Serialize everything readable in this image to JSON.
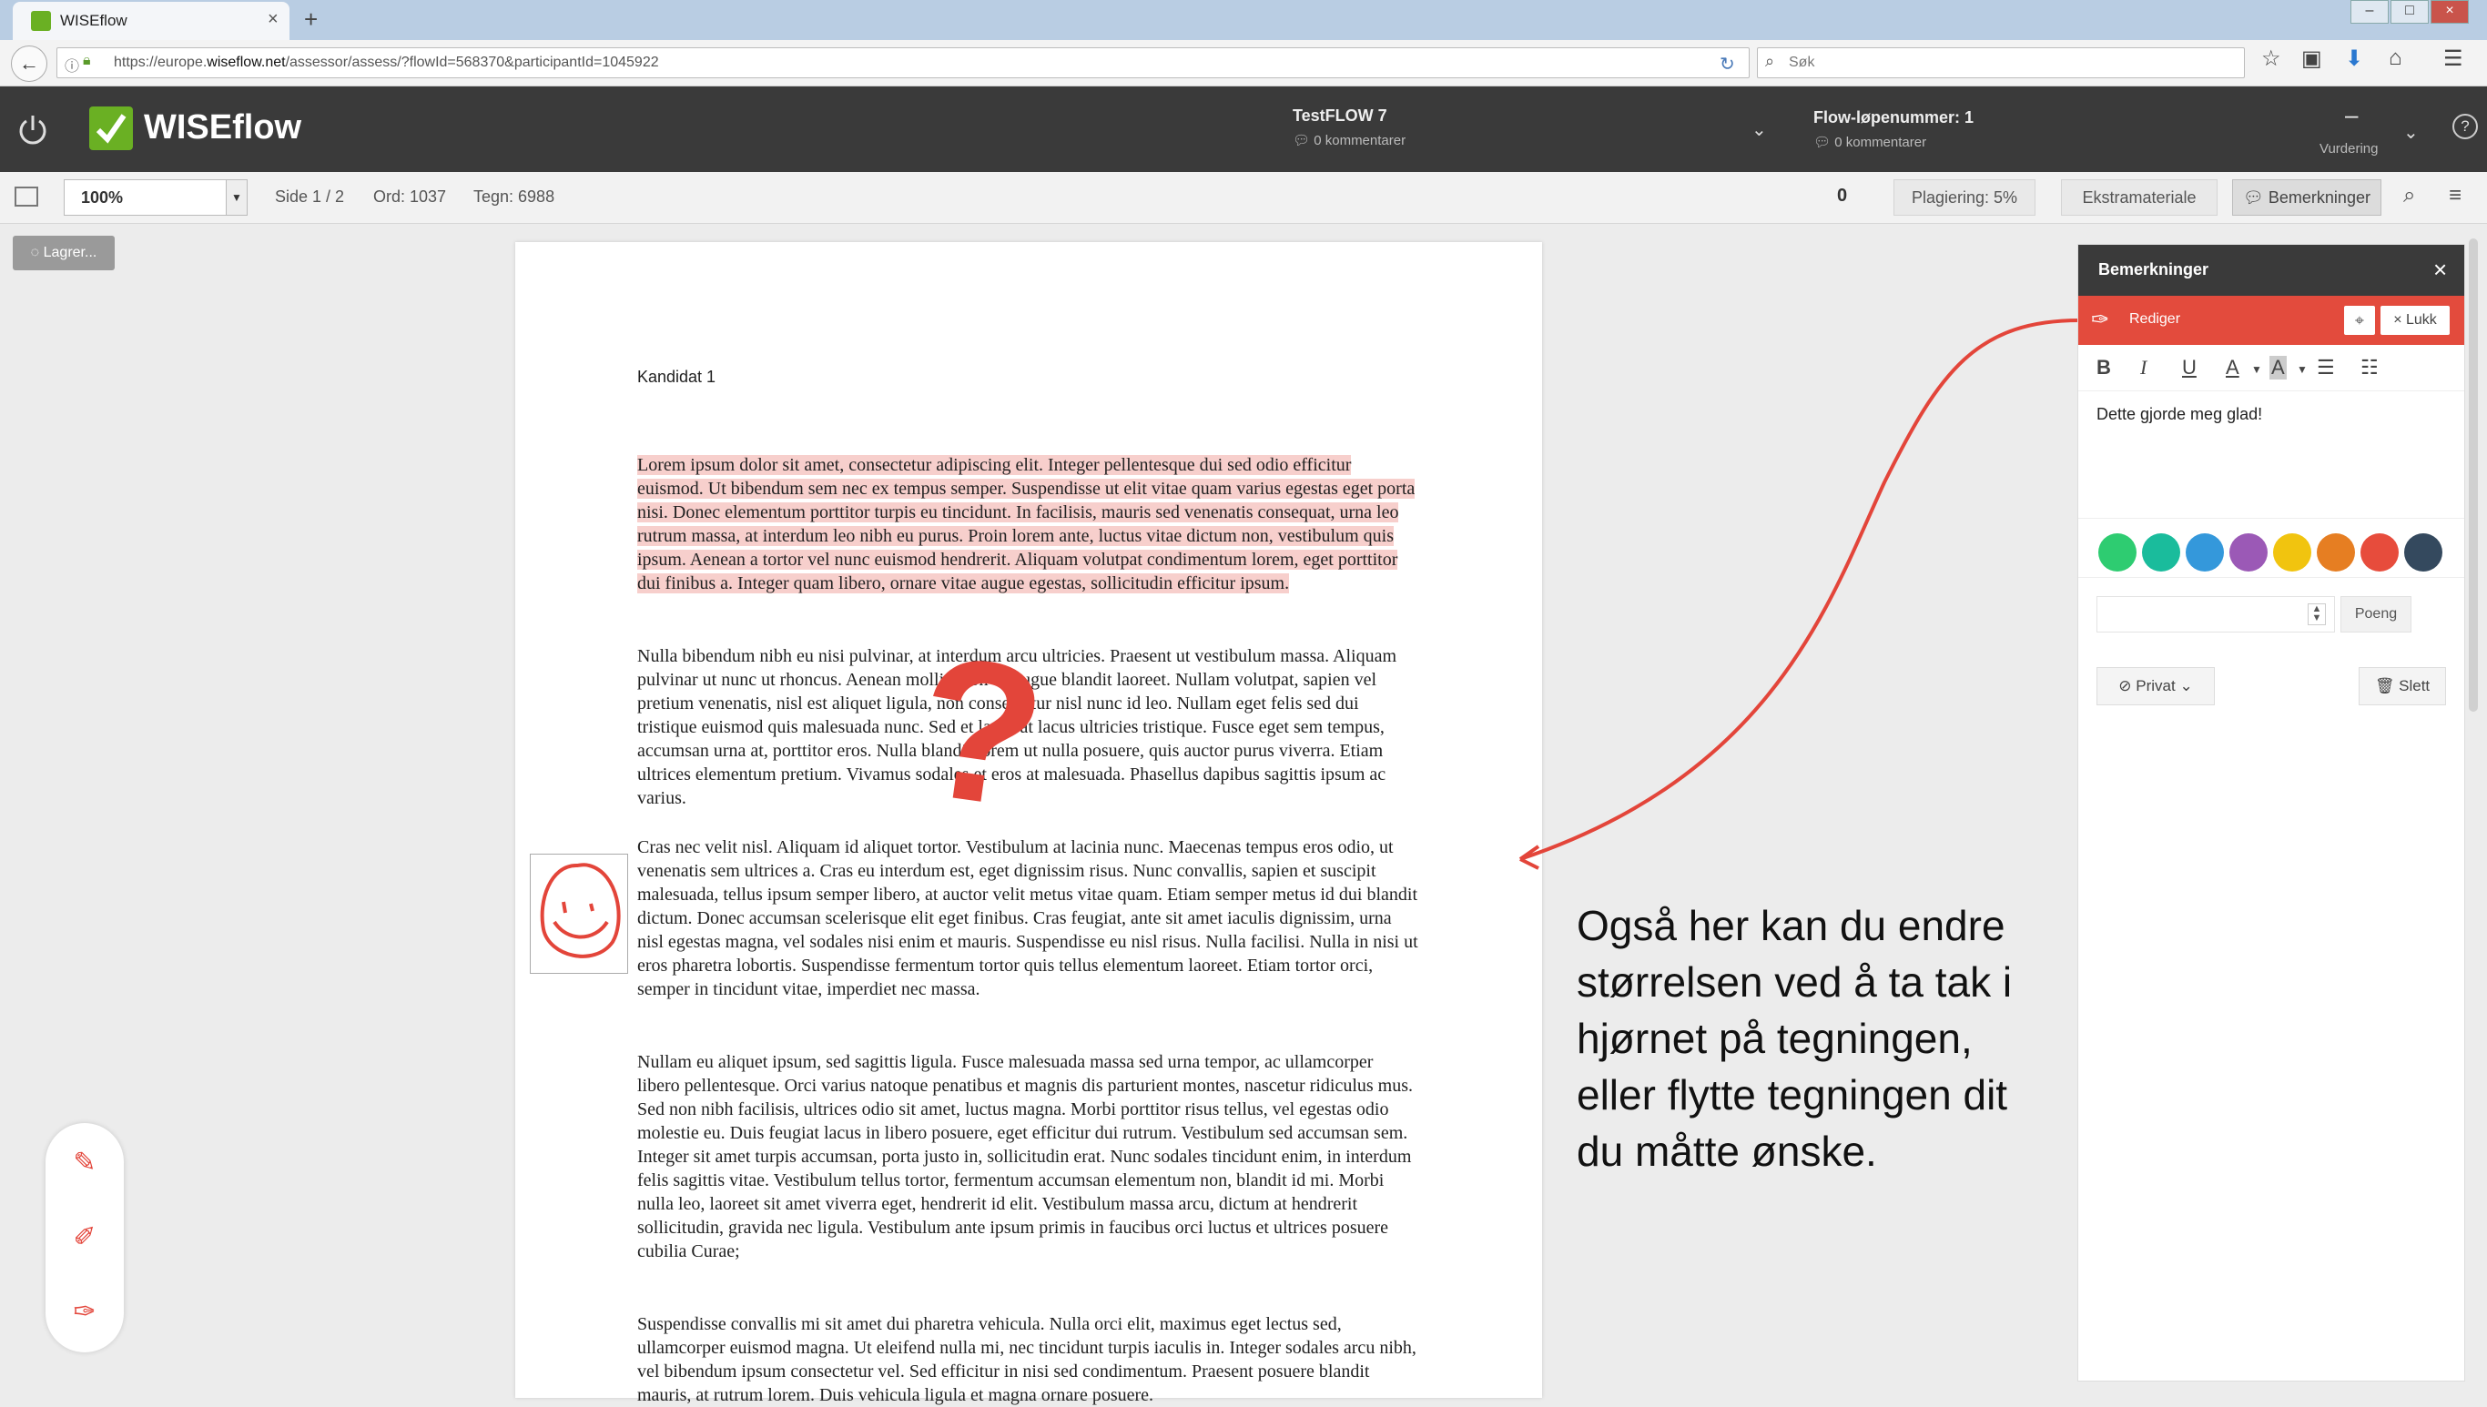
{
  "browser": {
    "tab_title": "WISEflow",
    "tab_close": "×",
    "new_tab": "+",
    "url_prefix": "https://europe.",
    "url_domain": "wiseflow.net",
    "url_rest": "/assessor/assess/?flowId=568370&participantId=1045922",
    "search_placeholder": "Søk"
  },
  "app": {
    "logo": "WISEflow",
    "flow_title": "TestFLOW 7",
    "flow_comments": "0 kommentarer",
    "flow_nr_label": "Flow-løpenummer: 1",
    "flow_nr_comments": "0 kommentarer",
    "vurdering_value": "–",
    "vurdering_label": "Vurdering",
    "help": "?"
  },
  "toolbar": {
    "zoom": "100%",
    "page": "Side 1 / 2",
    "words": "Ord: 1037",
    "chars": "Tegn: 6988",
    "count": "0",
    "plagiarism": "Plagiering: 5%",
    "extra": "Ekstramateriale",
    "remarks": "Bemerkninger"
  },
  "saving": "Lagrer...",
  "document": {
    "candidate": "Kandidat 1",
    "paragraphs": [
      "Lorem ipsum dolor sit amet, consectetur adipiscing elit. Integer pellentesque dui sed odio efficitur euismod. Ut bibendum sem nec ex tempus semper. Suspendisse ut elit vitae quam varius egestas eget porta nisi. Donec elementum porttitor turpis eu tincidunt. In facilisis, mauris sed venenatis consequat, urna leo rutrum massa, at interdum leo nibh eu purus. Proin lorem ante, luctus vitae dictum non, vestibulum quis ipsum. Aenean a tortor vel nunc euismod hendrerit. Aliquam volutpat condimentum lorem, eget porttitor dui finibus a. Integer quam libero, ornare vitae augue egestas, sollicitudin efficitur ipsum.",
      "Nulla bibendum nibh eu nisi pulvinar, at interdum arcu ultricies. Praesent ut vestibulum massa. Aliquam pulvinar ut nunc ut rhoncus. Aenean mollis nibh ac augue blandit laoreet. Nullam volutpat, sapien vel pretium venenatis, nisl est aliquet ligula, non consectetur nisl nunc id leo. Nullam eget felis sed dui tristique euismod quis malesuada nunc. Sed et lacus at lacus ultricies tristique. Fusce eget sem tempus, accumsan urna at, porttitor eros. Nulla blandit lorem ut nulla posuere, quis auctor purus viverra. Etiam ultrices elementum pretium. Vivamus sodales et eros at malesuada. Phasellus dapibus sagittis ipsum ac varius.",
      "Cras nec velit nisl. Aliquam id aliquet tortor. Vestibulum at lacinia nunc. Maecenas tempus eros odio, ut venenatis sem ultrices a. Cras eu interdum est, eget dignissim risus. Nunc convallis, sapien et suscipit malesuada, tellus ipsum semper libero, at auctor velit metus vitae quam. Etiam semper metus id dui blandit dictum. Donec accumsan scelerisque elit eget finibus. Cras feugiat, ante sit amet iaculis dignissim, urna nisl egestas magna, vel sodales nisi enim et mauris. Suspendisse eu nisl risus. Nulla facilisi. Nulla in nisi ut eros pharetra lobortis. Suspendisse fermentum tortor quis tellus elementum laoreet. Etiam tortor orci, semper in tincidunt vitae, imperdiet nec massa.",
      "Nullam eu aliquet ipsum, sed sagittis ligula. Fusce malesuada massa sed urna tempor, ac ullamcorper libero pellentesque. Orci varius natoque penatibus et magnis dis parturient montes, nascetur ridiculus mus. Sed non nibh facilisis, ultrices odio sit amet, luctus magna. Morbi porttitor risus tellus, vel egestas odio molestie eu. Duis feugiat lacus in libero posuere, eget efficitur dui rutrum. Vestibulum sed accumsan sem. Integer sit amet turpis accumsan, porta justo in, sollicitudin erat. Nunc sodales tincidunt enim, in interdum felis sagittis vitae. Vestibulum tellus tortor, fermentum accumsan elementum non, blandit id mi. Morbi nulla leo, laoreet sit amet viverra eget, hendrerit id elit. Vestibulum massa arcu, dictum at hendrerit sollicitudin, gravida nec ligula. Vestibulum ante ipsum primis in faucibus orci luctus et ultrices posuere cubilia Curae;",
      "Suspendisse convallis mi sit amet dui pharetra vehicula. Nulla orci elit, maximus eget lectus sed, ullamcorper euismod magna. Ut eleifend nulla mi, nec tincidunt turpis iaculis in. Integer sodales arcu nibh, vel bibendum ipsum consectetur vel. Sed efficitur in nisi sed condimentum. Praesent posuere blandit mauris, at rutrum lorem. Duis vehicula ligula et magna ornare posuere."
    ],
    "question_mark": "?"
  },
  "annotation": "Også her kan du endre størrelsen ved å ta tak i hjørnet på tegningen, eller flytte tegningen dit du måtte ønske.",
  "panel": {
    "title": "Bemerkninger",
    "close": "×",
    "rediger": "Rediger",
    "lukk": "× Lukk",
    "rt_bold": "B",
    "rt_italic": "I",
    "rt_underline": "U",
    "rt_color": "A",
    "rt_highlight": "A",
    "comment": "Dette gjorde meg glad!",
    "points_label": "Poeng",
    "privat": "Privat",
    "slett": "Slett",
    "colors": [
      "#2ecc71",
      "#1abc9c",
      "#3498db",
      "#9b59b6",
      "#f1c40f",
      "#e67e22",
      "#e74c3c",
      "#34495e"
    ]
  },
  "icons": {
    "back": "back-arrow-icon",
    "power": "power-icon",
    "pen": "pen-icon",
    "marker": "marker-icon",
    "eraser": "eraser-icon"
  }
}
